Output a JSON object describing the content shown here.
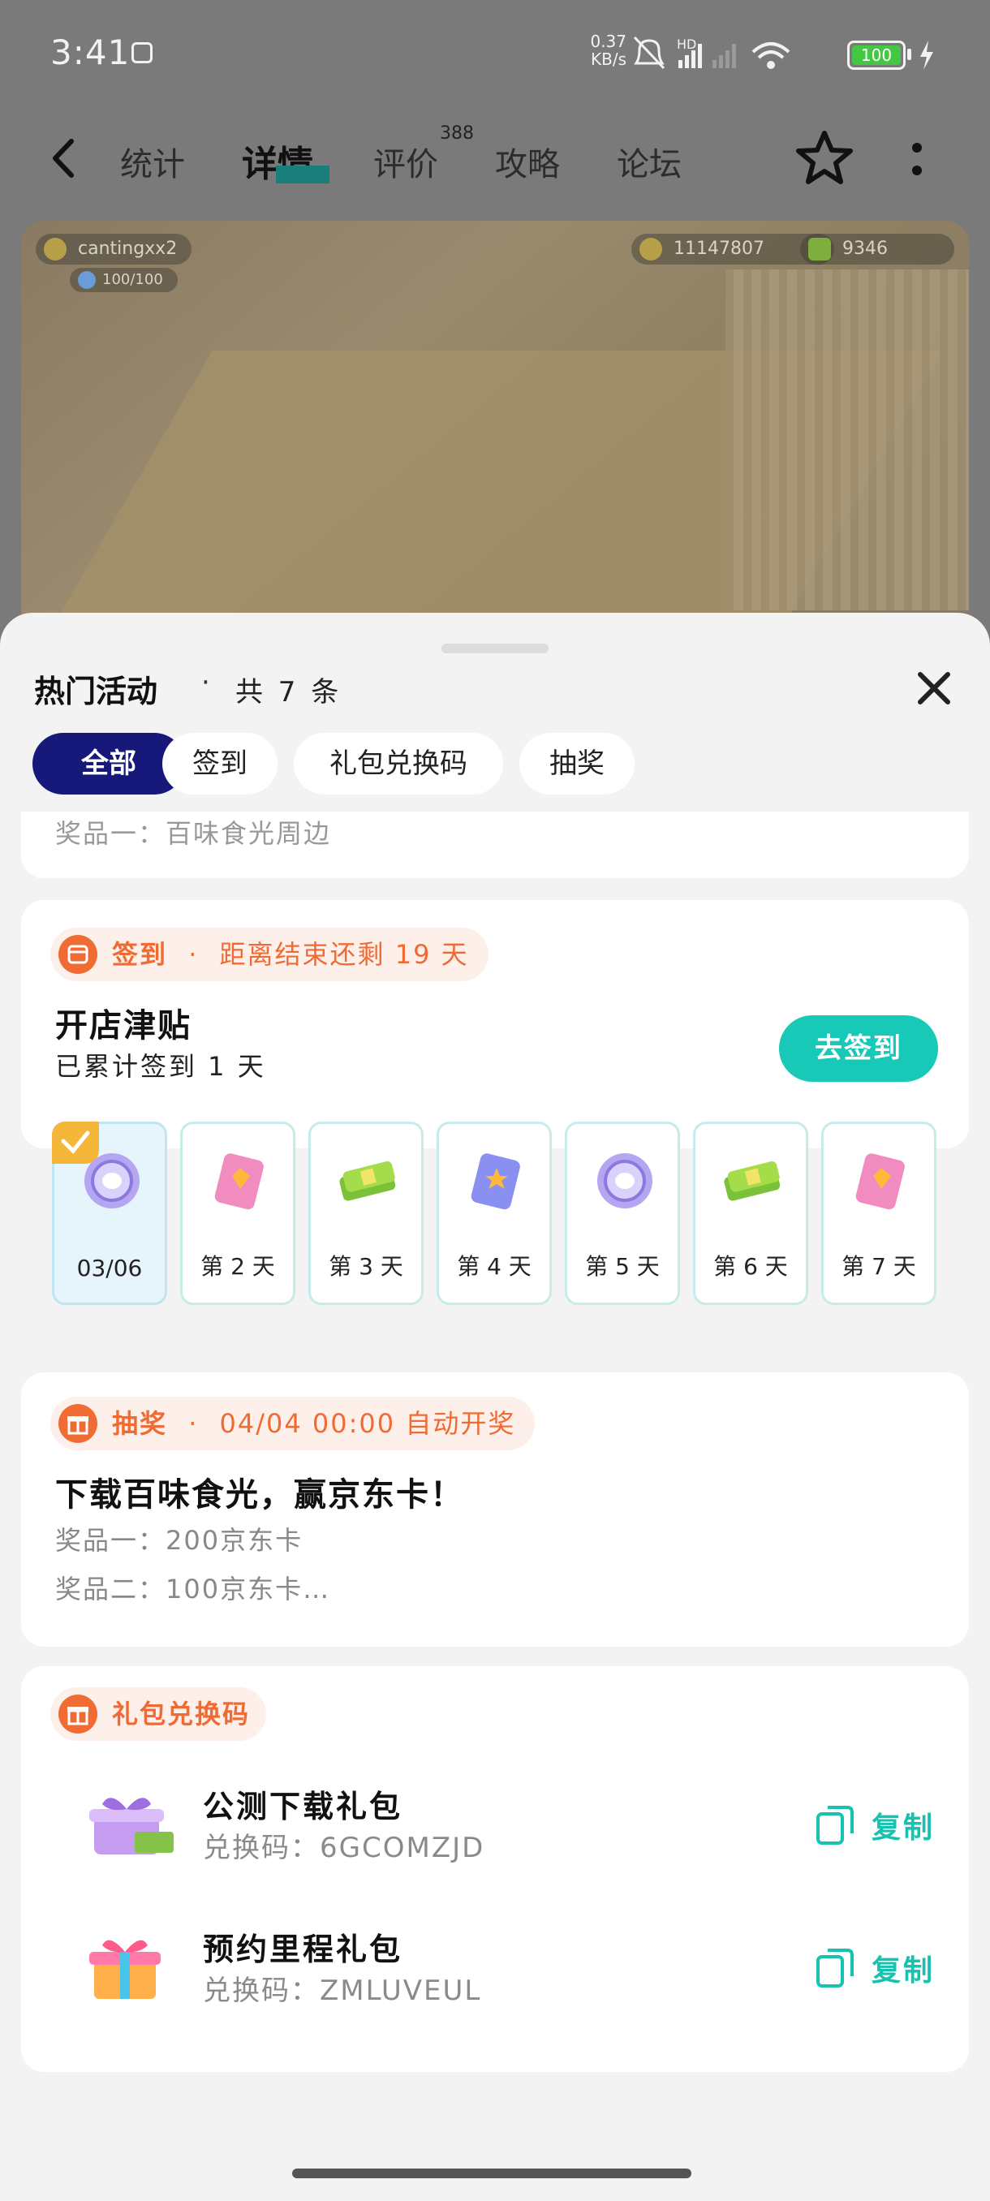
{
  "status_bar": {
    "time": "3:41",
    "net_speed_value": "0.37",
    "net_speed_unit": "KB/s",
    "hd_label": "HD",
    "wifi_label": "6",
    "battery_level": "100"
  },
  "nav": {
    "tabs": [
      {
        "label": "统计"
      },
      {
        "label": "详情"
      },
      {
        "label": "评价"
      },
      {
        "label": "攻略"
      },
      {
        "label": "论坛"
      }
    ],
    "review_count": "388"
  },
  "banner": {
    "username": "cantingxx2",
    "stamina": "100/100",
    "coins": "11147807",
    "cash": "9346"
  },
  "sheet": {
    "title": "热门活动",
    "dot": "·",
    "count": "共 7 条",
    "filters": [
      {
        "label": "全部"
      },
      {
        "label": "签到"
      },
      {
        "label": "礼包兑换码"
      },
      {
        "label": "抽奖"
      }
    ]
  },
  "partial_card": {
    "prize": "奖品一：百味食光周边"
  },
  "signin_card": {
    "tag_type": "签到",
    "tag_dot": "·",
    "tag_text": "距离结束还剩 19 天",
    "title": "开店津贴",
    "subtitle": "已累计签到 1 天",
    "button": "去签到",
    "days": [
      {
        "label": "03/06",
        "reward": "coin-token"
      },
      {
        "label": "第 2 天",
        "reward": "gem-ticket"
      },
      {
        "label": "第 3 天",
        "reward": "cash-stack"
      },
      {
        "label": "第 4 天",
        "reward": "star-ticket"
      },
      {
        "label": "第 5 天",
        "reward": "coin-token"
      },
      {
        "label": "第 6 天",
        "reward": "cash-stack"
      },
      {
        "label": "第 7 天",
        "reward": "gem-ticket"
      }
    ]
  },
  "lottery_card": {
    "tag_type": "抽奖",
    "tag_dot": "·",
    "tag_text": "04/04 00:00 自动开奖",
    "title": "下载百味食光，赢京东卡！",
    "prize1": "奖品一：200京东卡",
    "prize2": "奖品二：100京东卡…"
  },
  "gift_card": {
    "tag_type": "礼包兑换码",
    "gifts": [
      {
        "name": "公测下载礼包",
        "code": "兑换码：6GCOMZJD",
        "copy": "复制"
      },
      {
        "name": "预约里程礼包",
        "code": "兑换码：ZMLUVEUL",
        "copy": "复制"
      }
    ]
  },
  "colors": {
    "accent_teal": "#17c9b6",
    "tag_orange": "#ef6b33",
    "active_chip": "#16197a"
  }
}
